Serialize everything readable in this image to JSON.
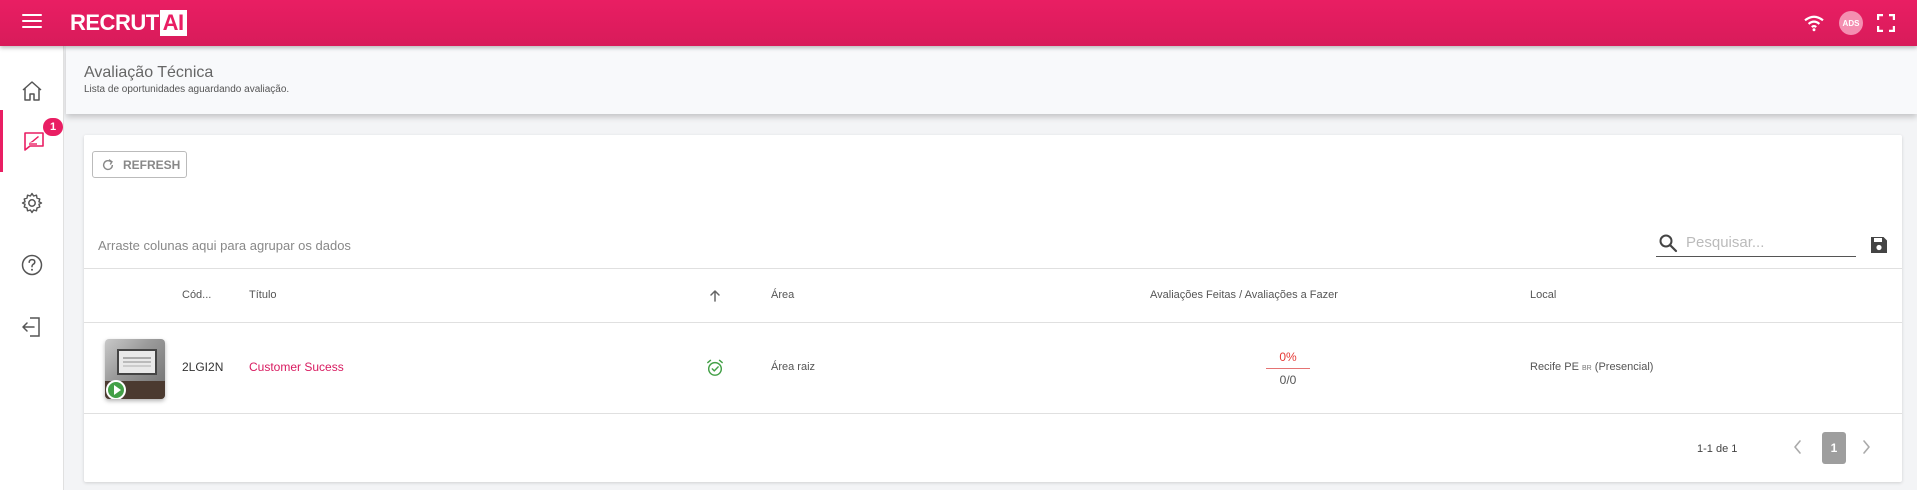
{
  "app": {
    "logo_main": "RECRUT",
    "logo_ai": "AI",
    "user_initials": "ADS",
    "brand_color": "#e91e63"
  },
  "sidebar": {
    "items": [
      {
        "name": "home",
        "icon": "home-icon"
      },
      {
        "name": "technical-evaluation",
        "icon": "evaluation-icon",
        "active": true,
        "badge": "1"
      },
      {
        "name": "settings",
        "icon": "gear-icon"
      },
      {
        "name": "help",
        "icon": "help-icon"
      },
      {
        "name": "logout",
        "icon": "logout-icon"
      }
    ]
  },
  "header": {
    "title": "Avaliação Técnica",
    "subtitle": "Lista de oportunidades aguardando avaliação."
  },
  "toolbar": {
    "refresh_label": "REFRESH",
    "group_hint": "Arraste colunas aqui para agrupar os dados",
    "search_placeholder": "Pesquisar..."
  },
  "table": {
    "columns": {
      "code": "Cód...",
      "title": "Título",
      "area": "Área",
      "evaluations": "Avaliações Feitas / Avaliações a Fazer",
      "local": "Local"
    },
    "rows": [
      {
        "code": "2LGI2N",
        "title": "Customer Sucess",
        "area": "Área raiz",
        "progress_pct": "0%",
        "progress_ratio": "0/0",
        "local_city": "Recife PE",
        "local_country": "BR",
        "local_mode": "(Presencial)"
      }
    ]
  },
  "pager": {
    "info": "1-1 de 1",
    "current_page": "1"
  }
}
